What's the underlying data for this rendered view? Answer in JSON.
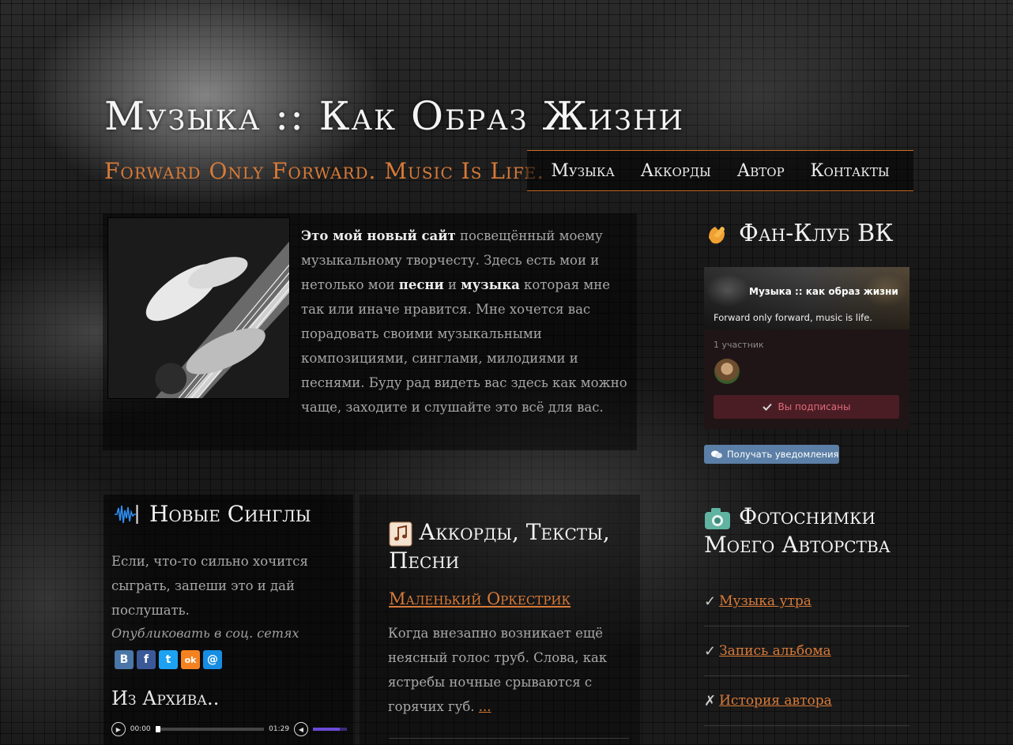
{
  "header": {
    "title": "Музыка :: Как Образ Жизни",
    "tagline": "Forward Only Forward. Music Is Life."
  },
  "nav": {
    "items": [
      {
        "label": "Музыка"
      },
      {
        "label": "Аккорды"
      },
      {
        "label": "Автор"
      },
      {
        "label": "Контакты"
      }
    ]
  },
  "intro": {
    "bold_lead": "Это мой новый сайт",
    "text_1": " посвещённый моему музыкальному творчесту. Здесь есть мои и нетолько мои ",
    "bold_songs": "песни",
    "text_2": " и ",
    "bold_music": "музыка",
    "text_3": " которая мне так или иначе нравится. Мне хочется вас порадовать своими музыкальными композициями, синглами, милодиями и песнями. Буду рад видеть вас здесь как можно чаще, заходите и слушайте это всё для вас."
  },
  "fanclub": {
    "title": "Фан-Клуб ВК",
    "group_name": "Музыка :: как образ жизни",
    "group_desc": "Forward only forward, music is life.",
    "members": "1 участник",
    "subscribed_label": "Вы подписаны",
    "notify_label": "Получать уведомления",
    "colors": {
      "subscribed_bg": "#4a1d24",
      "subscribed_text": "#e06a7a",
      "notify_bg": "#5b7fa6"
    }
  },
  "singles": {
    "title": "Новые Синглы",
    "text": "Если, что-то сильно хочится сыграть, запеши это и дай послушать.",
    "share_label": "Опубликовать в соц. сетях",
    "social": [
      {
        "icon": "vk-icon",
        "glyph": "В",
        "color": "#4a76a8"
      },
      {
        "icon": "facebook-icon",
        "glyph": "f",
        "color": "#3b5998"
      },
      {
        "icon": "twitter-icon",
        "glyph": "t",
        "color": "#1da1f2"
      },
      {
        "icon": "odnoklassniki-icon",
        "glyph": "ok",
        "color": "#f58220"
      },
      {
        "icon": "mail-icon",
        "glyph": "@",
        "color": "#168de2"
      }
    ],
    "archive_title": "Из Архива..",
    "player": {
      "current": "00:00",
      "duration": "01:29",
      "progress": 0.0,
      "volume": 0.8
    }
  },
  "chords": {
    "title": "Аккорды, Тексты, Песни",
    "post_title": "Маленький Оркестрик",
    "excerpt": "Когда внезапно возникает ещё неясный голос труб. Слова, как ястребы ночные срываются с горячих губ. ",
    "more": "..."
  },
  "photos": {
    "title": "Фотоснимки Моего Авторства",
    "items": [
      {
        "mark": "✓",
        "label": "Музыка утра"
      },
      {
        "mark": "✓",
        "label": "Запись альбома"
      },
      {
        "mark": "✗",
        "label": "История автора"
      }
    ]
  },
  "colors": {
    "accent": "#d87a38",
    "text": "#a8a8a8",
    "heading": "#f2f2f2"
  }
}
